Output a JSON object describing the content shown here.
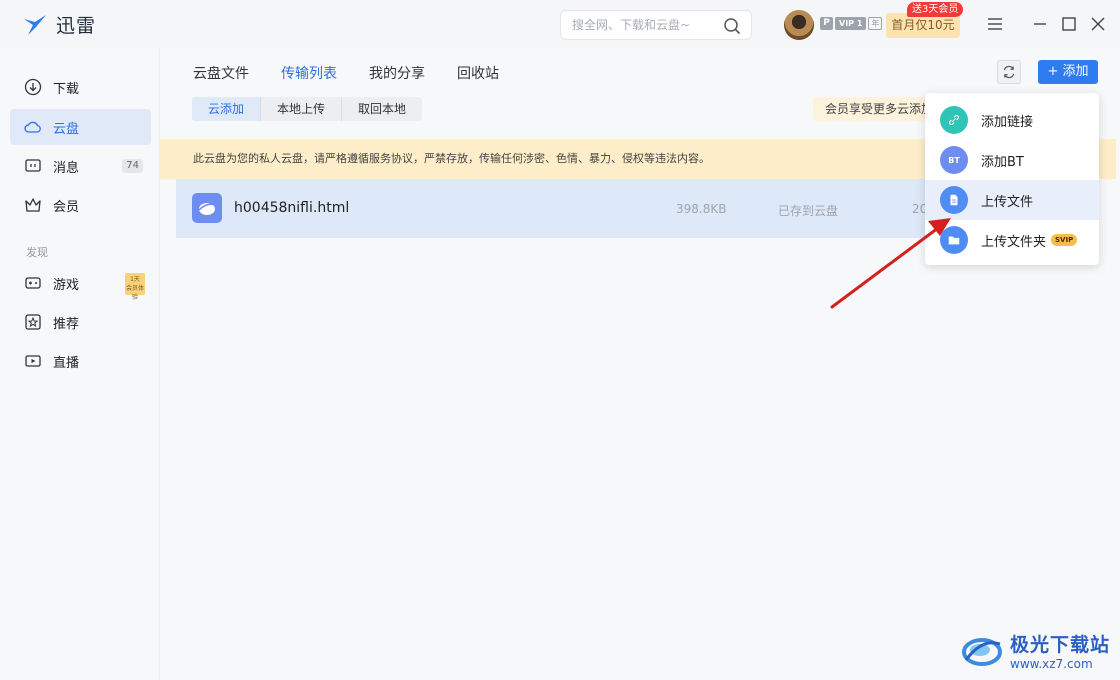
{
  "app": {
    "name": "迅雷"
  },
  "search": {
    "placeholder": "搜全网、下载和云盘~"
  },
  "account": {
    "vip_p": "P",
    "vip_level": "VIP 1",
    "vip_year": "年",
    "promo": "首月仅10元",
    "promo_tag": "送3天会员"
  },
  "sidebar": {
    "items": [
      {
        "label": "下载"
      },
      {
        "label": "云盘"
      },
      {
        "label": "消息",
        "count": "74"
      },
      {
        "label": "会员"
      }
    ],
    "section_label": "发现",
    "discover": [
      {
        "label": "游戏",
        "badge_top": "1天",
        "badge_bottom": "会员体验"
      },
      {
        "label": "推荐"
      },
      {
        "label": "直播"
      }
    ]
  },
  "main": {
    "tabs": [
      {
        "label": "云盘文件"
      },
      {
        "label": "传输列表"
      },
      {
        "label": "我的分享"
      },
      {
        "label": "回收站"
      }
    ],
    "subtabs": [
      {
        "label": "云添加"
      },
      {
        "label": "本地上传"
      },
      {
        "label": "取回本地"
      }
    ],
    "add_label": "添加",
    "vip_hint": "会员享受更多云添加",
    "notice": "此云盘为您的私人云盘，请严格遵循服务协议，严禁存放，传输任何涉密、色情、暴力、侵权等违法内容。",
    "files": [
      {
        "name": "h00458nifli.html",
        "size": "398.8KB",
        "status": "已存到云盘",
        "date": "20"
      }
    ]
  },
  "menu": {
    "items": [
      {
        "label": "添加链接",
        "color": "#2ec4b6"
      },
      {
        "label": "添加BT",
        "color": "#6e8df0",
        "icon_text": "BT"
      },
      {
        "label": "上传文件",
        "color": "#4f8df5"
      },
      {
        "label": "上传文件夹",
        "color": "#4f8df5",
        "tag": "SVIP"
      }
    ]
  },
  "watermark": {
    "title": "极光下载站",
    "url": "www.xz7.com"
  },
  "colors": {
    "accent": "#2f7bf0",
    "active_bg": "#dfe9f8",
    "notice_bg": "#fdeec9",
    "arrow": "#d42020"
  }
}
